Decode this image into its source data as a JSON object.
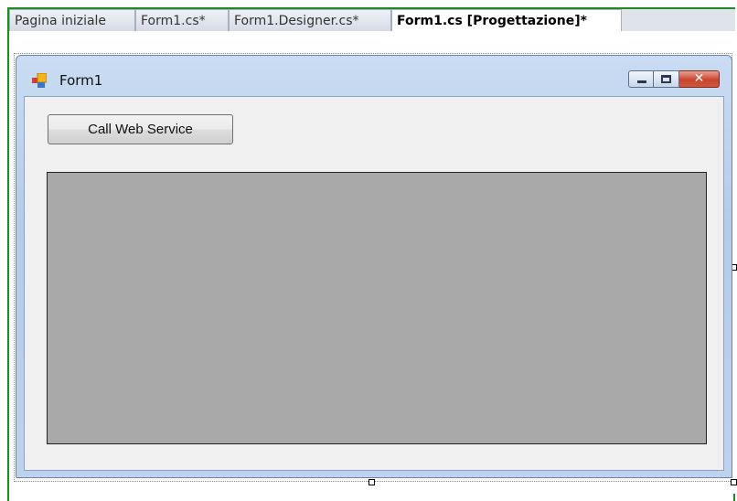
{
  "tabs": [
    {
      "label": "Pagina iniziale",
      "active": false
    },
    {
      "label": "Form1.cs*",
      "active": false
    },
    {
      "label": "Form1.Designer.cs*",
      "active": false
    },
    {
      "label": "Form1.cs [Progettazione]*",
      "active": true
    }
  ],
  "form": {
    "title": "Form1",
    "icon": "form-app-icon",
    "caption_buttons": {
      "minimize": "minimize-icon",
      "maximize": "maximize-icon",
      "close": "close-icon"
    }
  },
  "controls": {
    "call_button_label": "Call Web Service",
    "panel_color": "#a9a9a9"
  },
  "colors": {
    "designer_frame": "#1f8a1f",
    "window_border": "#6d82a5",
    "client_bg": "#f0f0f0",
    "close_button": "#c8452e"
  }
}
